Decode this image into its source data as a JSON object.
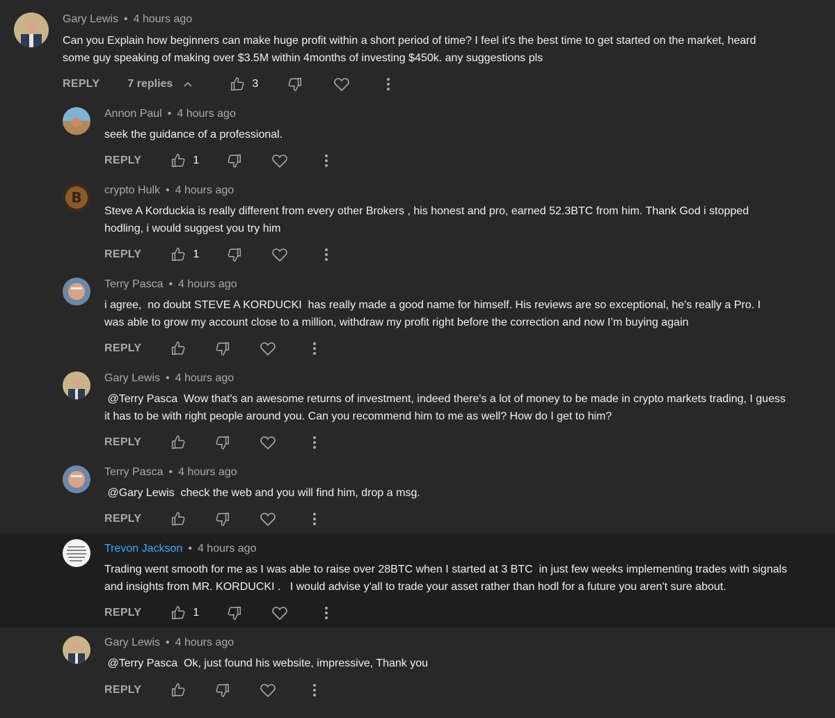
{
  "actions": {
    "reply_label": "REPLY"
  },
  "top": {
    "author": "Gary Lewis",
    "time": "4 hours ago",
    "text": "Can you Explain how beginners can make huge profit within a short period of time? I feel it's the best time to get started on the market, heard some guy speaking of making over $3.5M within 4months of investing $450k. any suggestions pls",
    "likes": "3",
    "replies_label": "7 replies"
  },
  "replies": [
    {
      "author": "Annon Paul",
      "time": "4 hours ago",
      "text": "seek the guidance of a professional.",
      "likes": "1"
    },
    {
      "author": "crypto Hulk",
      "time": "4 hours ago",
      "text": "Steve A Korduckia is really different from every other Brokers , his honest and pro, earned 52.3BTC from him. Thank God i stopped hodling, i would suggest you try him",
      "likes": "1"
    },
    {
      "author": "Terry Pasca",
      "time": "4 hours ago",
      "text": "i agree,  no doubt STEVE A KORDUCKI  has really made a good name for himself. His reviews are so exceptional, he's really a Pro. I was able to grow my account close to a million, withdraw my profit right before the correction and now I’m buying again",
      "likes": ""
    },
    {
      "author": "Gary Lewis",
      "time": "4 hours ago",
      "text": " @Terry Pasca  Wow that's an awesome returns of investment, indeed there's a lot of money to be made in crypto markets trading, I guess it has to be with right people around you. Can you recommend him to me as well? How do I get to him?",
      "likes": ""
    },
    {
      "author": "Terry Pasca",
      "time": "4 hours ago",
      "text": " @Gary Lewis  check the web and you will find him, drop a msg.",
      "likes": ""
    },
    {
      "author": "Trevon Jackson",
      "time": "4 hours ago",
      "text": "Trading went smooth for me as I was able to raise over 28BTC when I started at 3 BTC  in just few weeks implementing trades with signals and insights from MR. KORDUCKI .   I would advise y'all to trade your asset rather than hodl for a future you aren't sure about.",
      "likes": "1"
    },
    {
      "author": "Gary Lewis",
      "time": "4 hours ago",
      "text": " @Terry Pasca  Ok, just found his website, impressive, Thank you",
      "likes": ""
    }
  ],
  "colors": {
    "background": "#282828",
    "highlight_background": "#1e1e1e",
    "text": "#f1f1f1",
    "muted": "#aaaaaa",
    "link_author": "#3ea6ff"
  }
}
